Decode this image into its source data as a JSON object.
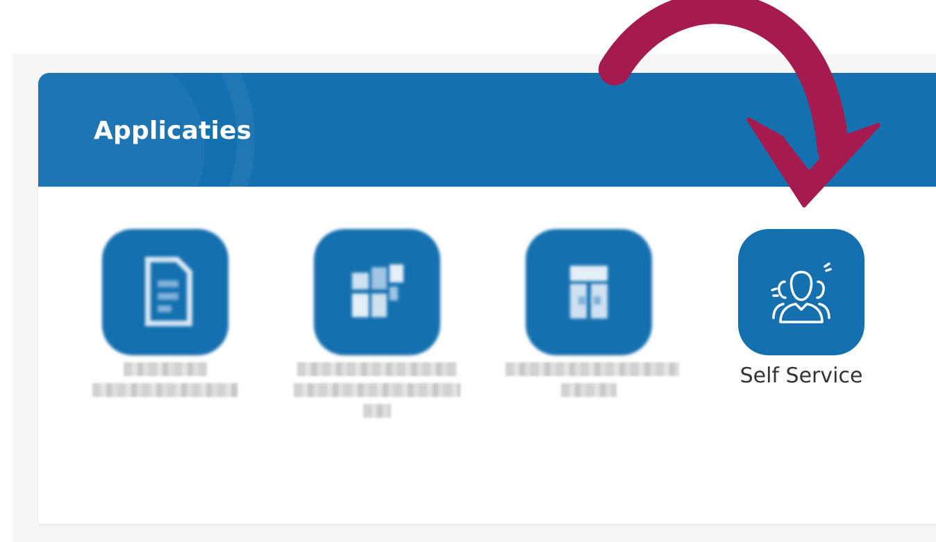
{
  "panel": {
    "title": "Applicaties"
  },
  "apps": [
    {
      "label": "",
      "icon": "document-icon",
      "redacted": true
    },
    {
      "label": "",
      "icon": "chart-icon",
      "redacted": true
    },
    {
      "label": "",
      "icon": "building-icon",
      "redacted": true
    },
    {
      "label": "Self Service",
      "icon": "users-icon",
      "redacted": false
    }
  ],
  "colors": {
    "header": "#1570b0",
    "icon_bg": "#1570b0",
    "arrow": "#a51a4f",
    "label": "#333333"
  },
  "annotation": {
    "icon": "curved-arrow-icon"
  }
}
